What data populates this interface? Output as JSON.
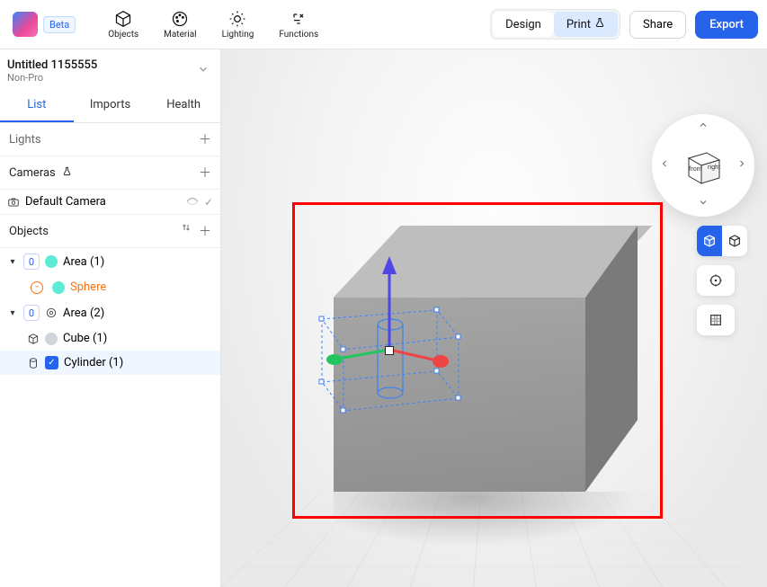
{
  "app": {
    "beta_label": "Beta"
  },
  "toolbar": {
    "objects": "Objects",
    "material": "Material",
    "lighting": "Lighting",
    "functions": "Functions",
    "design": "Design",
    "print": "Print",
    "share": "Share",
    "export": "Export"
  },
  "project": {
    "title": "Untitled 1155555",
    "subtitle": "Non-Pro"
  },
  "tabs": {
    "list": "List",
    "imports": "Imports",
    "health": "Health"
  },
  "sections": {
    "lights": "Lights",
    "cameras": "Cameras",
    "objects": "Objects"
  },
  "tree": {
    "default_camera": "Default Camera",
    "area1": {
      "badge": "0",
      "label": "Area (1)"
    },
    "sphere": "Sphere",
    "area2": {
      "badge": "0",
      "label": "Area (2)"
    },
    "cube": "Cube (1)",
    "cylinder": "Cylinder (1)"
  },
  "navcube": {
    "front": "front",
    "right": "right"
  }
}
